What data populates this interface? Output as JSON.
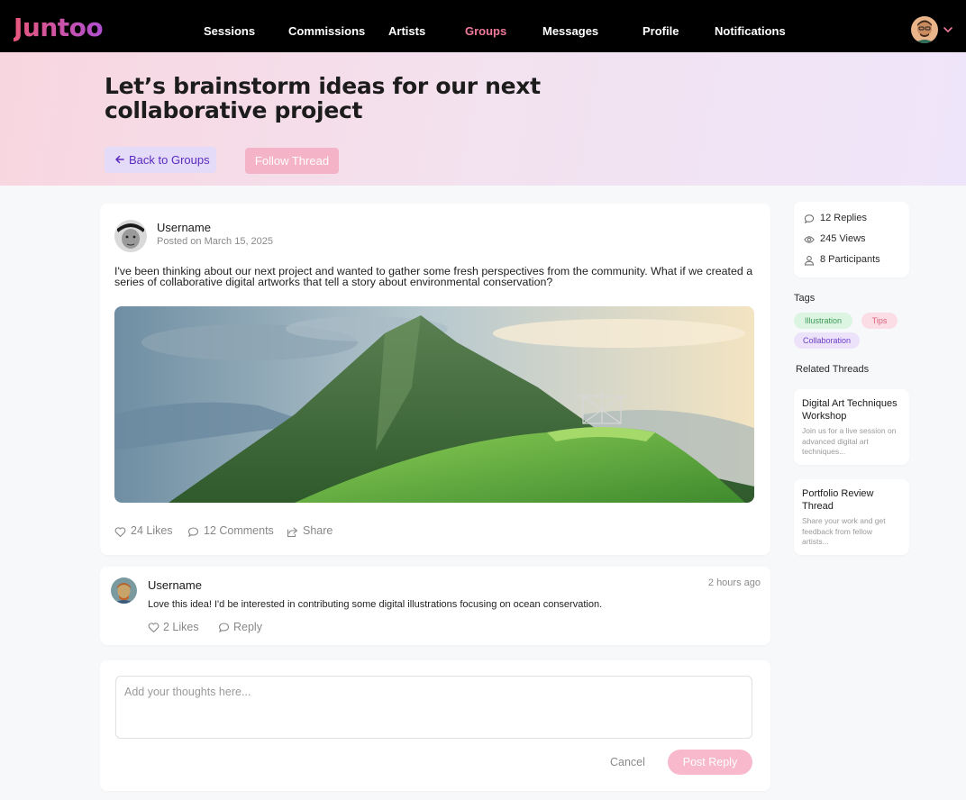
{
  "app": {
    "logo": "Juntoo"
  },
  "nav": {
    "items": [
      "Sessions",
      "Commissions",
      "Artists",
      "Groups",
      "Messages",
      "Profile",
      "Notifications"
    ],
    "active": "Groups"
  },
  "hero": {
    "title": "Let’s brainstorm ideas for our next collaborative project",
    "back_label": "Back to Groups",
    "follow_label": "Follow Thread"
  },
  "post": {
    "username": "Username",
    "date": "Posted on March 15, 2025",
    "body": "I've been thinking about our next project and wanted to gather some fresh perspectives from the community. What if we created a series of collaborative digital artworks that tell a story about environmental conservation?",
    "likes": "24 Likes",
    "comments": "12 Comments",
    "share": "Share"
  },
  "comment": {
    "username": "Username",
    "time": "2 hours ago",
    "body": "Love this idea! I'd be interested in contributing some digital illustrations focusing on ocean conservation.",
    "likes": "2 Likes",
    "reply": "Reply"
  },
  "reply_box": {
    "placeholder": "Add your thoughts here...",
    "cancel": "Cancel",
    "post": "Post Reply"
  },
  "sidebar": {
    "stats": {
      "replies": "12 Replies",
      "views": "245 Views",
      "participants": "8 Participants"
    },
    "tags_heading": "Tags",
    "tags": [
      "Illustration",
      "Tips",
      "Collaboration"
    ],
    "related_heading": "Related Threads",
    "related": [
      {
        "title": "Digital Art Techniques Workshop",
        "desc": "Join us for a live session on advanced digital art techniques..."
      },
      {
        "title": "Portfolio Review Thread",
        "desc": "Share your work and get feedback from fellow artists..."
      }
    ]
  },
  "colors": {
    "accent_pink": "#f07a9b",
    "accent_purple": "#5b2bbd",
    "nav_bg": "#000000"
  }
}
